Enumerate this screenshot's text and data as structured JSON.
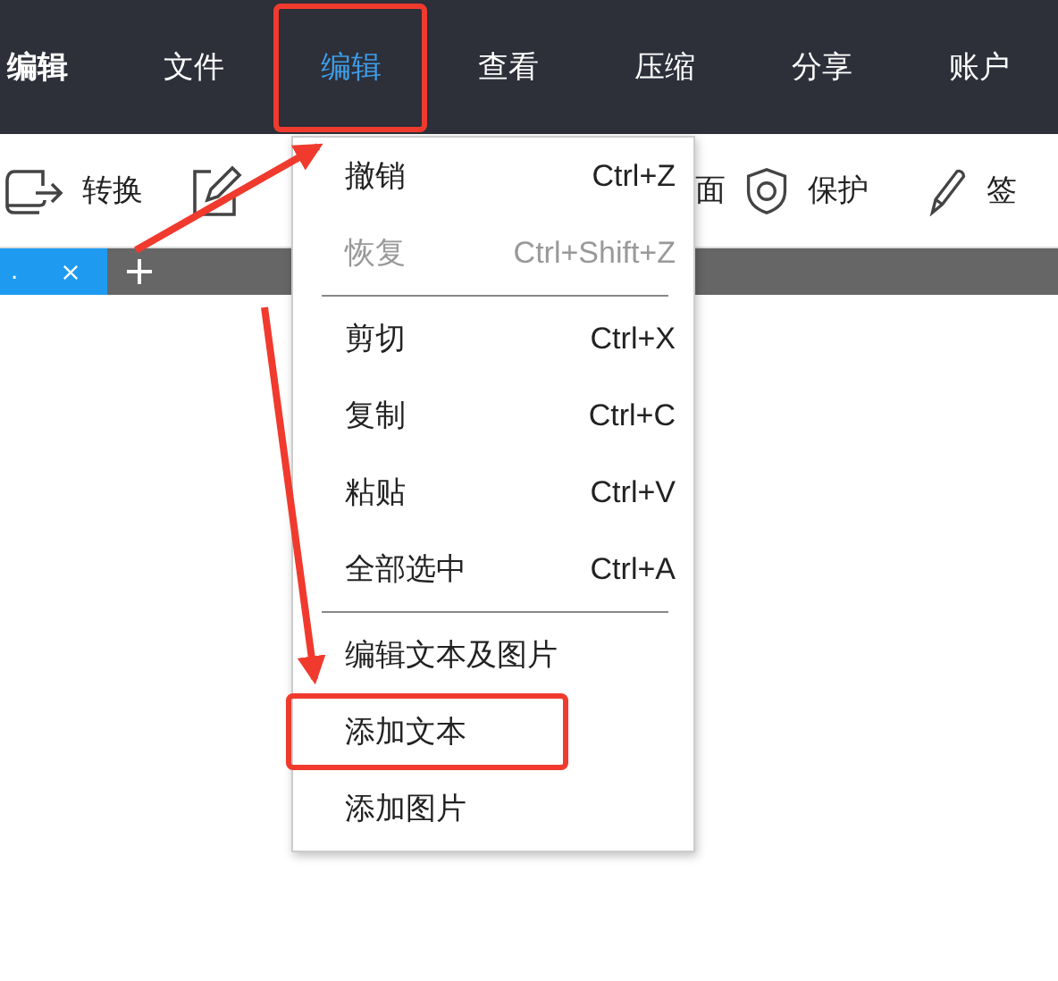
{
  "app_title": "编辑",
  "menu_bar": [
    {
      "label": "文件",
      "selected": false,
      "highlighted": false
    },
    {
      "label": "编辑",
      "selected": true,
      "highlighted": true
    },
    {
      "label": "查看",
      "selected": false,
      "highlighted": false
    },
    {
      "label": "压缩",
      "selected": false,
      "highlighted": false
    },
    {
      "label": "分享",
      "selected": false,
      "highlighted": false
    },
    {
      "label": "账户",
      "selected": false,
      "highlighted": false
    }
  ],
  "toolbar": [
    {
      "kind": "convert",
      "label": "转换"
    },
    {
      "kind": "edit"
    },
    {
      "kind": "none",
      "label": "面"
    },
    {
      "kind": "protect",
      "label": "保护"
    },
    {
      "kind": "sign",
      "label": "签"
    }
  ],
  "tabs": [
    {
      "label": ".",
      "selected": true
    }
  ],
  "edit_menu": [
    {
      "kind": "item",
      "label": "撤销",
      "shortcut": "Ctrl+Z",
      "disabled": false,
      "highlighted": false
    },
    {
      "kind": "item",
      "label": "恢复",
      "shortcut": "Ctrl+Shift+Z",
      "disabled": true,
      "highlighted": false
    },
    {
      "kind": "divider"
    },
    {
      "kind": "item",
      "label": "剪切",
      "shortcut": "Ctrl+X",
      "disabled": false,
      "highlighted": false
    },
    {
      "kind": "item",
      "label": "复制",
      "shortcut": "Ctrl+C",
      "disabled": false,
      "highlighted": false
    },
    {
      "kind": "item",
      "label": "粘贴",
      "shortcut": "Ctrl+V",
      "disabled": false,
      "highlighted": false
    },
    {
      "kind": "item",
      "label": "全部选中",
      "shortcut": "Ctrl+A",
      "disabled": false,
      "highlighted": false
    },
    {
      "kind": "divider"
    },
    {
      "kind": "item",
      "label": "编辑文本及图片",
      "disabled": false,
      "highlighted": false
    },
    {
      "kind": "item",
      "label": "添加文本",
      "disabled": false,
      "highlighted": true
    },
    {
      "kind": "item",
      "label": "添加图片",
      "disabled": false,
      "highlighted": false
    }
  ]
}
